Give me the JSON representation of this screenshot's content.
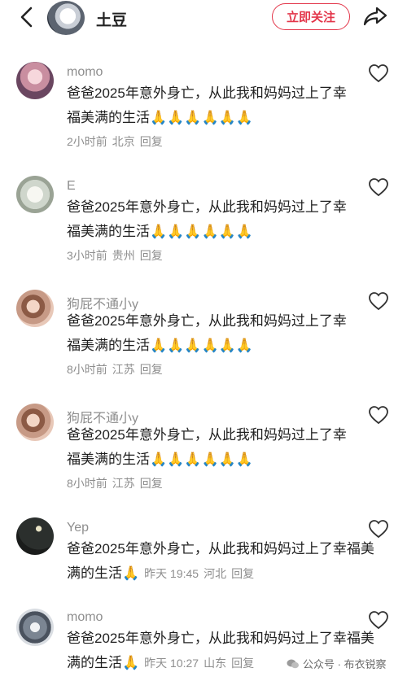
{
  "header": {
    "back_icon": "chevron-left-icon",
    "username": "土豆",
    "follow_label": "立即关注",
    "share_icon": "share-arrow-icon",
    "accent_color": "#e3364a"
  },
  "comments": [
    {
      "name": "momo",
      "text": "爸爸2025年意外身亡，从此我和妈妈过上了幸福美满的生活",
      "emoji": "🙏🙏🙏🙏🙏🙏",
      "time": "2小时前",
      "location": "北京",
      "reply": "回复"
    },
    {
      "name": "E",
      "text": "爸爸2025年意外身亡，从此我和妈妈过上了幸福美满的生活",
      "emoji": "🙏🙏🙏🙏🙏🙏",
      "time": "3小时前",
      "location": "贵州",
      "reply": "回复"
    },
    {
      "name": "狗屁不通小y",
      "text": "爸爸2025年意外身亡，从此我和妈妈过上了幸福美满的生活",
      "emoji": "🙏🙏🙏🙏🙏🙏",
      "time": "8小时前",
      "location": "江苏",
      "reply": "回复"
    },
    {
      "name": "狗屁不通小y",
      "text": "爸爸2025年意外身亡，从此我和妈妈过上了幸福美满的生活",
      "emoji": "🙏🙏🙏🙏🙏🙏",
      "time": "8小时前",
      "location": "江苏",
      "reply": "回复"
    },
    {
      "name": "Yep",
      "text": "爸爸2025年意外身亡，从此我和妈妈过上了幸福美满的生活",
      "emoji": "🙏",
      "time": "昨天 19:45",
      "location": "河北",
      "reply": "回复"
    },
    {
      "name": "momo",
      "text": "爸爸2025年意外身亡，从此我和妈妈过上了幸福美满的生活",
      "emoji": "🙏",
      "time": "昨天 10:27",
      "location": "山东",
      "reply": "回复"
    }
  ],
  "watermark": "公众号 · 布衣锐察"
}
